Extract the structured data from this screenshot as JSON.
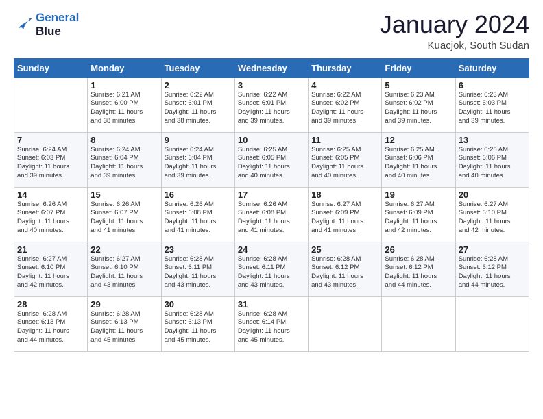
{
  "header": {
    "logo_line1": "General",
    "logo_line2": "Blue",
    "month": "January 2024",
    "location": "Kuacjok, South Sudan"
  },
  "days_of_week": [
    "Sunday",
    "Monday",
    "Tuesday",
    "Wednesday",
    "Thursday",
    "Friday",
    "Saturday"
  ],
  "weeks": [
    [
      {
        "num": "",
        "info": ""
      },
      {
        "num": "1",
        "info": "Sunrise: 6:21 AM\nSunset: 6:00 PM\nDaylight: 11 hours\nand 38 minutes."
      },
      {
        "num": "2",
        "info": "Sunrise: 6:22 AM\nSunset: 6:01 PM\nDaylight: 11 hours\nand 38 minutes."
      },
      {
        "num": "3",
        "info": "Sunrise: 6:22 AM\nSunset: 6:01 PM\nDaylight: 11 hours\nand 39 minutes."
      },
      {
        "num": "4",
        "info": "Sunrise: 6:22 AM\nSunset: 6:02 PM\nDaylight: 11 hours\nand 39 minutes."
      },
      {
        "num": "5",
        "info": "Sunrise: 6:23 AM\nSunset: 6:02 PM\nDaylight: 11 hours\nand 39 minutes."
      },
      {
        "num": "6",
        "info": "Sunrise: 6:23 AM\nSunset: 6:03 PM\nDaylight: 11 hours\nand 39 minutes."
      }
    ],
    [
      {
        "num": "7",
        "info": "Sunrise: 6:24 AM\nSunset: 6:03 PM\nDaylight: 11 hours\nand 39 minutes."
      },
      {
        "num": "8",
        "info": "Sunrise: 6:24 AM\nSunset: 6:04 PM\nDaylight: 11 hours\nand 39 minutes."
      },
      {
        "num": "9",
        "info": "Sunrise: 6:24 AM\nSunset: 6:04 PM\nDaylight: 11 hours\nand 39 minutes."
      },
      {
        "num": "10",
        "info": "Sunrise: 6:25 AM\nSunset: 6:05 PM\nDaylight: 11 hours\nand 40 minutes."
      },
      {
        "num": "11",
        "info": "Sunrise: 6:25 AM\nSunset: 6:05 PM\nDaylight: 11 hours\nand 40 minutes."
      },
      {
        "num": "12",
        "info": "Sunrise: 6:25 AM\nSunset: 6:06 PM\nDaylight: 11 hours\nand 40 minutes."
      },
      {
        "num": "13",
        "info": "Sunrise: 6:26 AM\nSunset: 6:06 PM\nDaylight: 11 hours\nand 40 minutes."
      }
    ],
    [
      {
        "num": "14",
        "info": "Sunrise: 6:26 AM\nSunset: 6:07 PM\nDaylight: 11 hours\nand 40 minutes."
      },
      {
        "num": "15",
        "info": "Sunrise: 6:26 AM\nSunset: 6:07 PM\nDaylight: 11 hours\nand 41 minutes."
      },
      {
        "num": "16",
        "info": "Sunrise: 6:26 AM\nSunset: 6:08 PM\nDaylight: 11 hours\nand 41 minutes."
      },
      {
        "num": "17",
        "info": "Sunrise: 6:26 AM\nSunset: 6:08 PM\nDaylight: 11 hours\nand 41 minutes."
      },
      {
        "num": "18",
        "info": "Sunrise: 6:27 AM\nSunset: 6:09 PM\nDaylight: 11 hours\nand 41 minutes."
      },
      {
        "num": "19",
        "info": "Sunrise: 6:27 AM\nSunset: 6:09 PM\nDaylight: 11 hours\nand 42 minutes."
      },
      {
        "num": "20",
        "info": "Sunrise: 6:27 AM\nSunset: 6:10 PM\nDaylight: 11 hours\nand 42 minutes."
      }
    ],
    [
      {
        "num": "21",
        "info": "Sunrise: 6:27 AM\nSunset: 6:10 PM\nDaylight: 11 hours\nand 42 minutes."
      },
      {
        "num": "22",
        "info": "Sunrise: 6:27 AM\nSunset: 6:10 PM\nDaylight: 11 hours\nand 43 minutes."
      },
      {
        "num": "23",
        "info": "Sunrise: 6:28 AM\nSunset: 6:11 PM\nDaylight: 11 hours\nand 43 minutes."
      },
      {
        "num": "24",
        "info": "Sunrise: 6:28 AM\nSunset: 6:11 PM\nDaylight: 11 hours\nand 43 minutes."
      },
      {
        "num": "25",
        "info": "Sunrise: 6:28 AM\nSunset: 6:12 PM\nDaylight: 11 hours\nand 43 minutes."
      },
      {
        "num": "26",
        "info": "Sunrise: 6:28 AM\nSunset: 6:12 PM\nDaylight: 11 hours\nand 44 minutes."
      },
      {
        "num": "27",
        "info": "Sunrise: 6:28 AM\nSunset: 6:12 PM\nDaylight: 11 hours\nand 44 minutes."
      }
    ],
    [
      {
        "num": "28",
        "info": "Sunrise: 6:28 AM\nSunset: 6:13 PM\nDaylight: 11 hours\nand 44 minutes."
      },
      {
        "num": "29",
        "info": "Sunrise: 6:28 AM\nSunset: 6:13 PM\nDaylight: 11 hours\nand 45 minutes."
      },
      {
        "num": "30",
        "info": "Sunrise: 6:28 AM\nSunset: 6:13 PM\nDaylight: 11 hours\nand 45 minutes."
      },
      {
        "num": "31",
        "info": "Sunrise: 6:28 AM\nSunset: 6:14 PM\nDaylight: 11 hours\nand 45 minutes."
      },
      {
        "num": "",
        "info": ""
      },
      {
        "num": "",
        "info": ""
      },
      {
        "num": "",
        "info": ""
      }
    ]
  ],
  "accent_color": "#2a6bb5"
}
